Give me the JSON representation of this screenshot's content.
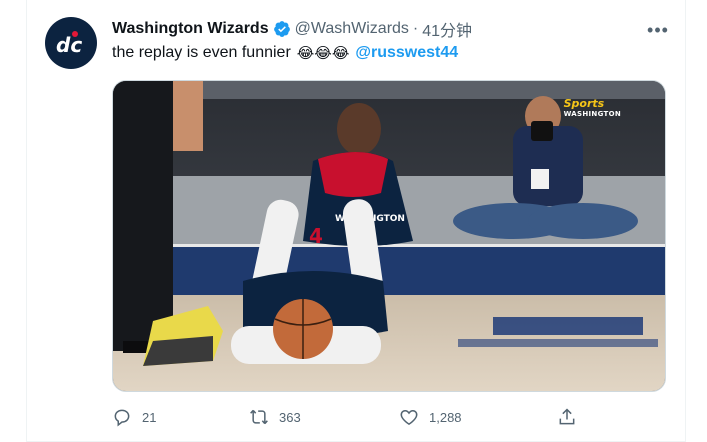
{
  "tweet": {
    "author_name": "Washington Wizards",
    "handle": "@WashWizards",
    "separator": "·",
    "time": "41分钟",
    "text": "the replay is even funnier",
    "emojis": "😂😂😂",
    "mention": "@russwest44",
    "more_label": "•••"
  },
  "media": {
    "broadcaster_line1": "Sports",
    "broadcaster_line2": "WASHINGTON",
    "jersey_text": "WASHINGTON",
    "jersey_number": "4"
  },
  "actions": {
    "reply_count": "21",
    "retweet_count": "363",
    "like_count": "1,288"
  },
  "colors": {
    "accent": "#1d9bf0",
    "secondary_text": "#536471",
    "avatar_bg": "#0c2340",
    "wizards_red": "#e31837"
  },
  "icons": {
    "avatar": "wizards-dc-logo-icon",
    "verified": "verified-badge-icon",
    "reply": "reply-bubble-icon",
    "retweet": "retweet-icon",
    "like": "heart-icon",
    "share": "share-upload-icon"
  }
}
